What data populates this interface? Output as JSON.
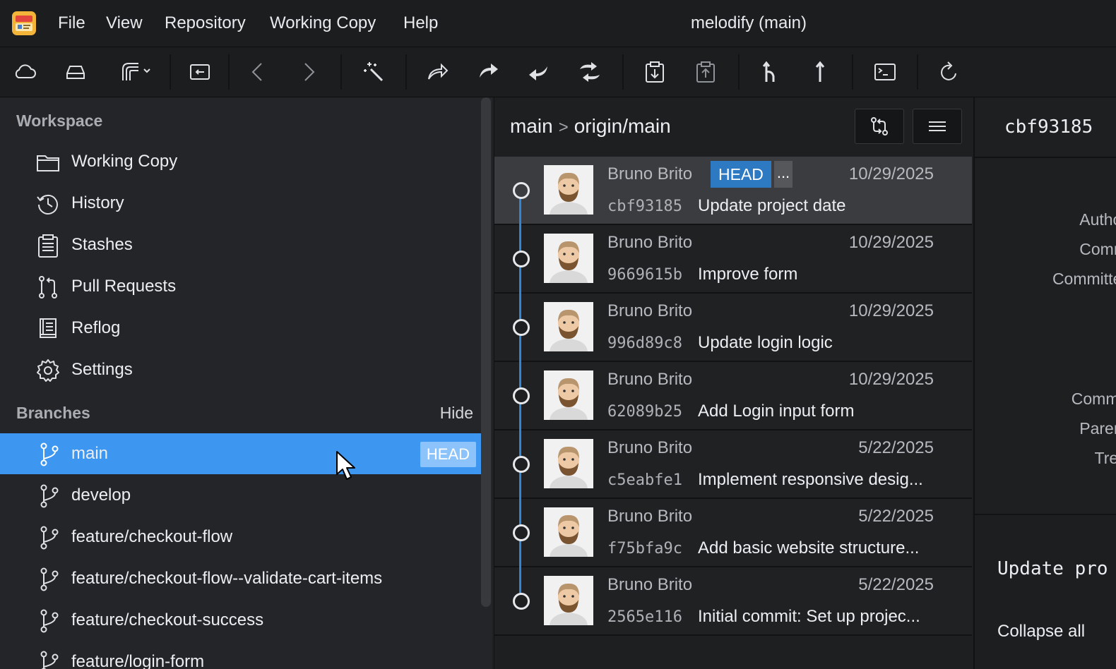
{
  "menubar": {
    "items": [
      "File",
      "View",
      "Repository",
      "Working Copy",
      "Help"
    ],
    "window_title": "melodify (main)"
  },
  "toolbar": {
    "buttons": [
      "cloud-icon",
      "drive-icon",
      "fetch-dropdown-icon",
      "open-repo-icon",
      "back-icon",
      "forward-icon",
      "magic-wand-icon",
      "share-icon",
      "undo-icon",
      "redo-icon",
      "sync-icon",
      "stash-icon",
      "stash-pop-icon",
      "merge-icon",
      "push-icon",
      "terminal-icon",
      "refresh-icon"
    ]
  },
  "sidebar": {
    "workspace_header": "Workspace",
    "workspace_items": [
      {
        "label": "Working Copy",
        "icon": "folder-icon"
      },
      {
        "label": "History",
        "icon": "history-icon"
      },
      {
        "label": "Stashes",
        "icon": "clipboard-icon"
      },
      {
        "label": "Pull Requests",
        "icon": "pull-request-icon"
      },
      {
        "label": "Reflog",
        "icon": "book-icon"
      },
      {
        "label": "Settings",
        "icon": "gear-icon"
      }
    ],
    "branches_header": "Branches",
    "hide_label": "Hide",
    "branches": [
      {
        "label": "main",
        "badge": "HEAD",
        "selected": true
      },
      {
        "label": "develop"
      },
      {
        "label": "feature/checkout-flow"
      },
      {
        "label": "feature/checkout-flow--validate-cart-items"
      },
      {
        "label": "feature/checkout-success"
      },
      {
        "label": "feature/login-form"
      }
    ]
  },
  "history": {
    "breadcrumb": {
      "branch": "main",
      "separator": ">",
      "remote": "origin/main"
    },
    "commits": [
      {
        "author": "Bruno Brito",
        "date": "10/29/2025",
        "hash": "cbf93185",
        "message": "Update project date",
        "head": "HEAD",
        "more": "...",
        "selected": true
      },
      {
        "author": "Bruno Brito",
        "date": "10/29/2025",
        "hash": "9669615b",
        "message": "Improve form"
      },
      {
        "author": "Bruno Brito",
        "date": "10/29/2025",
        "hash": "996d89c8",
        "message": "Update login logic"
      },
      {
        "author": "Bruno Brito",
        "date": "10/29/2025",
        "hash": "62089b25",
        "message": "Add Login input form"
      },
      {
        "author": "Bruno Brito",
        "date": "5/22/2025",
        "hash": "c5eabfe1",
        "message": "Implement responsive desig..."
      },
      {
        "author": "Bruno Brito",
        "date": "5/22/2025",
        "hash": "f75bfa9c",
        "message": "Add basic website structure..."
      },
      {
        "author": "Bruno Brito",
        "date": "5/22/2025",
        "hash": "2565e116",
        "message": "Initial commit: Set up projec..."
      }
    ]
  },
  "details": {
    "hash": "cbf93185",
    "labels": [
      "A",
      "Author",
      "Comm",
      "Committer",
      "Commit",
      "Parent",
      "Tree"
    ],
    "summary": "Update pro",
    "collapse_all": "Collapse all"
  },
  "colors": {
    "accent": "#3d97f0",
    "head_tag": "#2d79c2",
    "graph_line": "#2f86d6"
  }
}
